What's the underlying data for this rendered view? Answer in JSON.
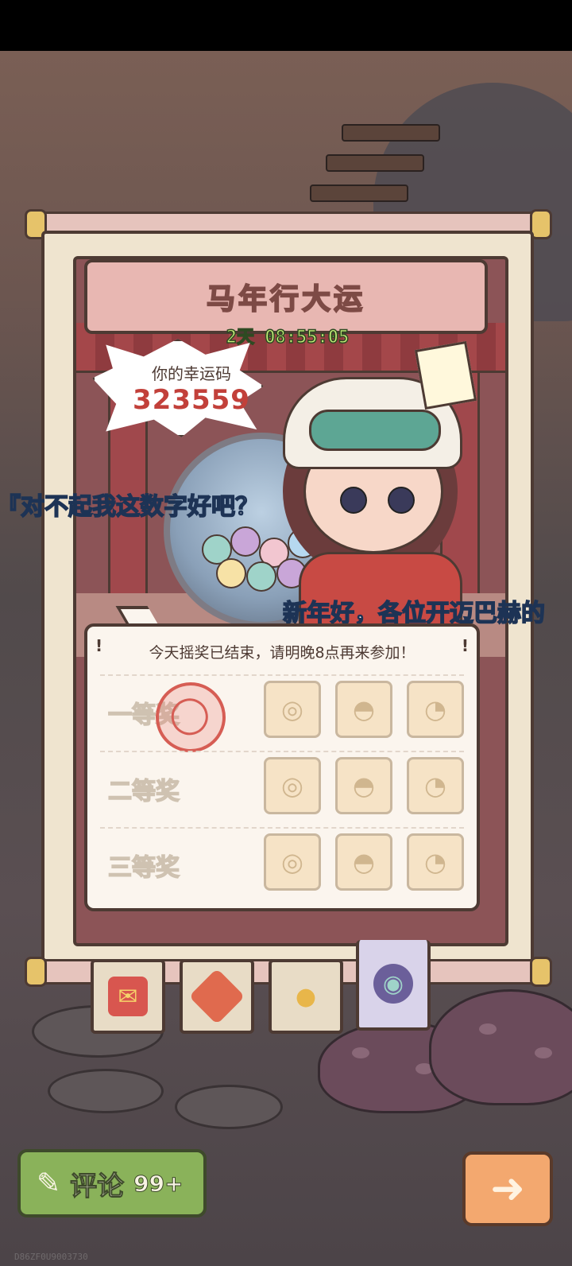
{
  "event": {
    "title": "马年行大运",
    "countdown": "2天 08:55:05"
  },
  "lucky_code": {
    "label": "你的幸运码",
    "code": "323559"
  },
  "dialogue": {
    "line_left": "『对不起我这数字好吧？",
    "line_right": "新年好，各位开迈巴赫的"
  },
  "prize_card": {
    "notice": "今天摇奖已结束，请明晚8点再来参加！",
    "bang": "!",
    "rows": [
      {
        "label": "一等奖",
        "stamped": true
      },
      {
        "label": "二等奖",
        "stamped": false
      },
      {
        "label": "三等奖",
        "stamped": false
      }
    ],
    "reward_icons": [
      "crystal-ball-icon",
      "dumpling-icon",
      "ghost-icon"
    ]
  },
  "tabs": [
    {
      "name": "red-envelope-tab",
      "icon": "red-envelope-icon",
      "active": false
    },
    {
      "name": "fortune-tab",
      "icon": "fu-diamond-icon",
      "active": false
    },
    {
      "name": "lollipop-tab",
      "icon": "lollipop-icon",
      "active": false
    },
    {
      "name": "lottery-tab",
      "icon": "gacha-machine-icon",
      "active": true
    }
  ],
  "buttons": {
    "comment_label": "评论",
    "comment_count": "99+",
    "next_icon": "arrow-right-icon"
  },
  "watermark": "D86ZF0U9003730",
  "colors": {
    "accent_red": "#c2403a",
    "timer_green": "#c8f07a",
    "comment_green": "#8ab25a",
    "next_orange": "#f3a86f"
  }
}
